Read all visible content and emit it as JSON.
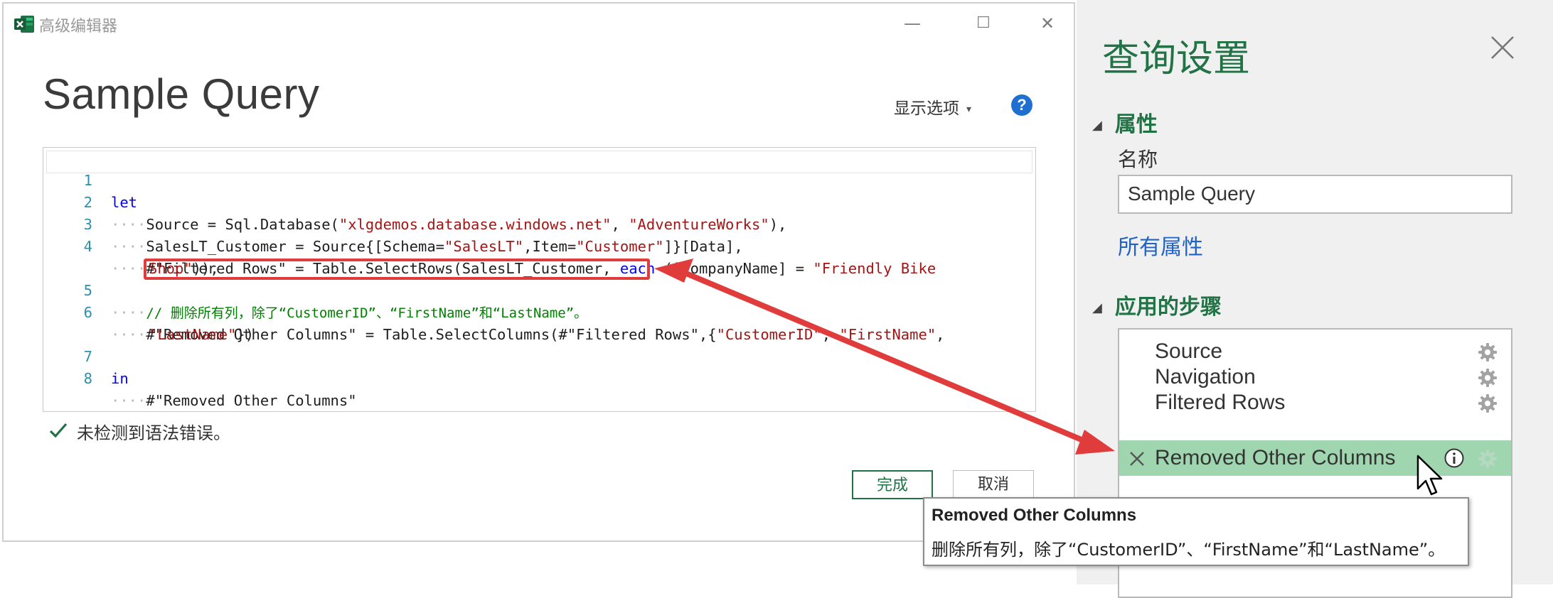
{
  "window": {
    "title": "高级编辑器",
    "minimize_glyph": "—",
    "maximize_glyph": "☐",
    "close_glyph": "✕"
  },
  "editor": {
    "query_name": "Sample Query",
    "display_options": "显示选项",
    "display_options_caret": "▾",
    "help_glyph": "?",
    "lines": [
      {
        "n": "1"
      },
      {
        "n": "2"
      },
      {
        "n": "3"
      },
      {
        "n": "4"
      },
      {
        "n": "5"
      },
      {
        "n": "6"
      },
      {
        "n": "7"
      },
      {
        "n": "8"
      }
    ],
    "tokens": {
      "let": "let",
      "l2_a": "Source = Sql.Database(",
      "l2_s1": "\"xlgdemos.database.windows.net\"",
      "l2_b": ", ",
      "l2_s2": "\"AdventureWorks\"",
      "l2_c": "),",
      "l3_a": "SalesLT_Customer = Source{[Schema=",
      "l3_s1": "\"SalesLT\"",
      "l3_b": ",Item=",
      "l3_s2": "\"Customer\"",
      "l3_c": "]}[Data],",
      "l4_a": "#\"Filtered Rows\" = Table.SelectRows(SalesLT_Customer, ",
      "l4_kw": "each",
      "l4_b": " ([CompanyName] = ",
      "l4_s1": "\"Friendly Bike",
      "l4_cont_s": "Shop\"",
      "l4_cont_b": ")),",
      "l5_comment": "// 删除所有列，除了“CustomerID”、“FirstName”和“LastName”。",
      "l6_a": "#\"Removed Other Columns\" = Table.SelectColumns(#\"Filtered Rows\",{",
      "l6_s1": "\"CustomerID\"",
      "l6_b": ", ",
      "l6_s2": "\"FirstName\"",
      "l6_c": ",",
      "l6_cont_s": "\"LastName\"",
      "l6_cont_b": "})",
      "in": "in",
      "l8": "#\"Removed Other Columns\""
    },
    "status": "未检测到语法错误。",
    "done_button": "完成",
    "cancel_button": "取消"
  },
  "settings": {
    "title": "查询设置",
    "properties_heading": "属性",
    "name_label": "名称",
    "name_value": "Sample Query",
    "all_properties_link": "所有属性",
    "steps_heading": "应用的步骤",
    "collapse_glyph": "◢",
    "steps": [
      {
        "label": "Source"
      },
      {
        "label": "Navigation"
      },
      {
        "label": "Filtered Rows"
      },
      {
        "label": "Removed Other Columns"
      }
    ]
  },
  "tooltip": {
    "title": "Removed Other Columns",
    "description": "删除所有列，除了“CustomerID”、“FirstName”和“LastName”。"
  },
  "colors": {
    "accent_green": "#217346",
    "selected_step": "#9fd6b0",
    "annotation_red": "#e03c3c",
    "link_blue": "#1f62c4"
  }
}
